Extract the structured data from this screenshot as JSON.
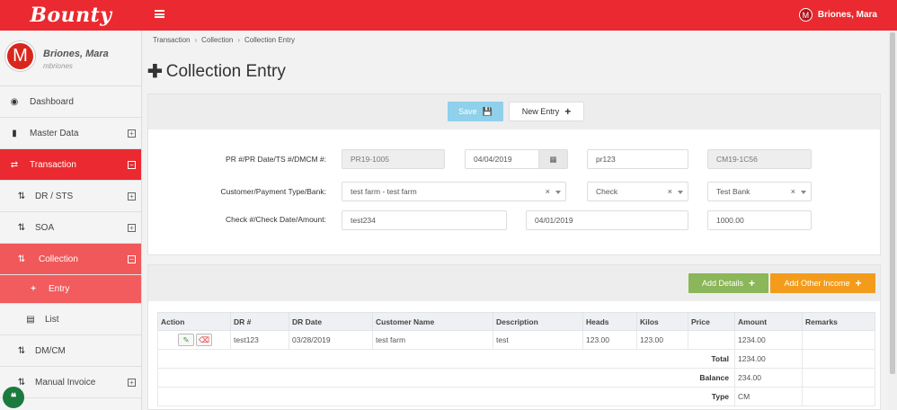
{
  "app": {
    "brand": "Bounty",
    "user": "Briones, Mara",
    "avatar_initial": "M"
  },
  "profile": {
    "name": "Briones, Mara",
    "username": "mbriones"
  },
  "sidebar": {
    "items": [
      {
        "label": "Dashboard",
        "icon": "dashboard-icon"
      },
      {
        "label": "Master Data",
        "icon": "book-icon"
      },
      {
        "label": "Transaction",
        "icon": "exchange-icon"
      },
      {
        "label": "DR / STS",
        "icon": "retweet-icon"
      },
      {
        "label": "SOA",
        "icon": "retweet-icon"
      },
      {
        "label": "Collection",
        "icon": "retweet-icon"
      },
      {
        "label": "Entry",
        "icon": "plus-icon"
      },
      {
        "label": "List",
        "icon": "list-icon"
      },
      {
        "label": "DM/CM",
        "icon": "retweet-icon"
      },
      {
        "label": "Manual Invoice",
        "icon": "retweet-icon"
      }
    ]
  },
  "breadcrumb": [
    "Transaction",
    "Collection",
    "Collection Entry"
  ],
  "page": {
    "title": "Collection Entry"
  },
  "toolbar": {
    "save_label": "Save",
    "new_entry_label": "New Entry"
  },
  "form": {
    "row1_label": "PR #/PR Date/TS #/DMCM #:",
    "pr_no": "PR19-1005",
    "pr_date": "04/04/2019",
    "ts_no": "pr123",
    "dmcm_no": "CM19-1C56",
    "row2_label": "Customer/Payment Type/Bank:",
    "customer": "test farm - test farm",
    "payment_type": "Check",
    "bank": "Test Bank",
    "row3_label": "Check #/Check Date/Amount:",
    "check_no": "test234",
    "check_date": "04/01/2019",
    "amount": "1000.00"
  },
  "details_toolbar": {
    "add_details_label": "Add Details",
    "add_other_income_label": "Add Other Income"
  },
  "table": {
    "headers": [
      "Action",
      "DR #",
      "DR Date",
      "Customer Name",
      "Description",
      "Heads",
      "Kilos",
      "Price",
      "Amount",
      "Remarks"
    ],
    "rows": [
      [
        "",
        "test123",
        "03/28/2019",
        "test farm",
        "test",
        "123.00",
        "123.00",
        "",
        "1234.00",
        ""
      ]
    ],
    "summary": [
      {
        "label": "Total",
        "value": "1234.00"
      },
      {
        "label": "Balance",
        "value": "234.00"
      },
      {
        "label": "Type",
        "value": "CM"
      }
    ]
  }
}
